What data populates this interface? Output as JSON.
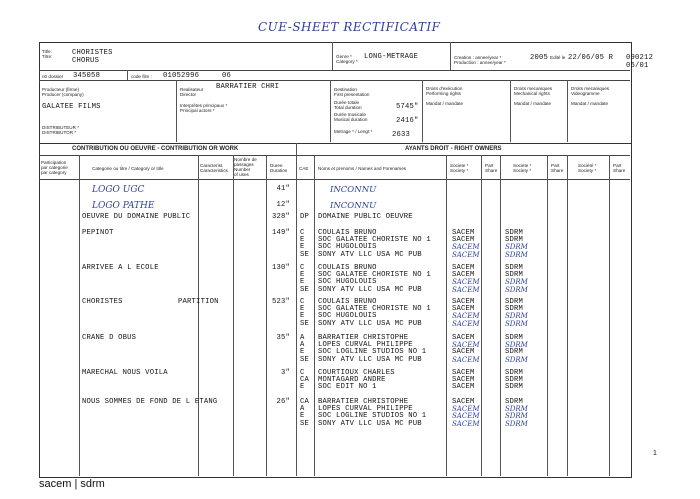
{
  "handwritten_title": "CUE-SHEET RECTIFICATIF",
  "header": {
    "title_label": "Title:\nTitre:",
    "title_value": "CHORISTES",
    "title_value2": "CHORUS",
    "genre_label": "Genre *\nCategory *",
    "genre_value": "LONG-METRAGE",
    "creation_label": "Creation : annee/year *\nProduction : annee/year *",
    "creation_value": "2005",
    "edite_label": "Edité le",
    "edite_value": "22/06/05 R",
    "docnum": "090212",
    "page": "05/01",
    "dossier_label": "n0 dossier",
    "dossier_value": "345058",
    "code_film_label": "code film :",
    "code_film_value": "01052996",
    "code_film_suffix": "06",
    "producteur_label": "Producteur (firme)\nProducer (company)",
    "producteur_value": "GALATEE FILMS",
    "realisateur_label": "Realisateur\nDirector",
    "realisateur_value": "BARRATIER CHRI",
    "interpretes_label": "Interprètes principaux *\nPrincipal actors *",
    "destination_label": "Destination\nFirst presentation",
    "duree_totale_label": "Durée totale\nTotal duration",
    "duree_totale_value": "5745\"",
    "duree_musicale_label": "Durée musicale\nMusical duration",
    "duree_musicale_value": "2416\"",
    "metrage_label": "Metrage * / Lengt *",
    "metrage_value": "2633",
    "distributeur_label": "DISTRIBUTEUR *\nDISTRIBUTOR *",
    "droits_exec_label": "Droits d'exécution\nPerforming rights",
    "droits_exec_value": "Mandat / mandate",
    "droits_meca_label": "Droits mecaniques\nMechanical rights",
    "droits_meca_value": "Mandat / mandate",
    "droits_video_label": "Droits mecaniques\nVideogramme",
    "droits_video_value": "Mandat / mandate"
  },
  "section_headers": {
    "contribution": "CONTRIBUTION OU OEUVRE - CONTRIBUTION OR WORK",
    "ayants": "AYANTS DROIT - RIGHT OWNERS"
  },
  "columns": {
    "participation": "Participation\npar categorie\npar category",
    "categorie": "Categorie ou titre / Category or title",
    "caracterist": "Caracterist.\nCaracteristics",
    "nombre": "Nombre de\npassages\nNumber\nof uses",
    "duree": "Duree\nDuration",
    "cae": "CAE",
    "noms": "Noms et prenoms / Names and Forenames",
    "societe1": "Societe *\nSociety *",
    "part1": "Part\nShare",
    "societe2": "Societe *\nSociety *",
    "part2": "Part\nShare",
    "societe3": "Société *\nSociety *",
    "part3": "Part\nShare"
  },
  "works": [
    {
      "title": "LOGO UGC",
      "handwritten": true,
      "duration": "41\"",
      "rows": [
        {
          "cae": "",
          "name": "INCONNU",
          "name_hand": true,
          "soc1": "",
          "soc2": ""
        }
      ]
    },
    {
      "title": "LOGO PATHE",
      "handwritten": true,
      "duration": "12\"",
      "rows": [
        {
          "cae": "",
          "name": "INCONNU",
          "name_hand": true,
          "soc1": "",
          "soc2": ""
        }
      ]
    },
    {
      "title": "OEUVRE DU DOMAINE PUBLIC",
      "duration": "328\"",
      "rows": [
        {
          "cae": "DP",
          "name": "DOMAINE PUBLIC OEUVRE",
          "soc1": "",
          "soc2": ""
        }
      ]
    },
    {
      "title": "PEPINOT",
      "duration": "149\"",
      "rows": [
        {
          "cae": "C",
          "name": "COULAIS BRUNO",
          "soc1": "SACEM",
          "soc2": "SDRM"
        },
        {
          "cae": "E",
          "name": "SOC GALATEE CHORISTE NO 1",
          "soc1": "SACEM",
          "soc2": "SDRM"
        },
        {
          "cae": "E",
          "name": "SOC HUGOLOUIS",
          "soc1": "SACEM",
          "soc1_hand": true,
          "soc2": "SDRM",
          "soc2_hand": true
        },
        {
          "cae": "SE",
          "name": "SONY ATV LLC USA MC PUB",
          "soc1": "SACEM",
          "soc1_hand": true,
          "soc2": "SDRM",
          "soc2_hand": true
        }
      ]
    },
    {
      "title": "ARRIVEE A L ECOLE",
      "duration": "130\"",
      "rows": [
        {
          "cae": "C",
          "name": "COULAIS BRUNO",
          "soc1": "SACEM",
          "soc2": "SDRM"
        },
        {
          "cae": "E",
          "name": "SOC GALATEE CHORISTE NO 1",
          "soc1": "SACEM",
          "soc2": "SDRM"
        },
        {
          "cae": "E",
          "name": "SOC HUGOLOUIS",
          "soc1": "SACEM",
          "soc1_hand": true,
          "soc2": "SDRM",
          "soc2_hand": true
        },
        {
          "cae": "SE",
          "name": "SONY ATV LLC USA MC PUB",
          "soc1": "SACEM",
          "soc1_hand": true,
          "soc2": "SDRM",
          "soc2_hand": true
        }
      ]
    },
    {
      "title": "CHORISTES",
      "title_extra": "PARTITION",
      "duration": "523\"",
      "rows": [
        {
          "cae": "C",
          "name": "COULAIS BRUNO",
          "soc1": "SACEM",
          "soc2": "SDRM"
        },
        {
          "cae": "E",
          "name": "SOC GALATEE CHORISTE NO 1",
          "soc1": "SACEM",
          "soc2": "SDRM"
        },
        {
          "cae": "E",
          "name": "SOC HUGOLOUIS",
          "soc1": "SACEM",
          "soc1_hand": true,
          "soc2": "SDRM",
          "soc2_hand": true
        },
        {
          "cae": "SE",
          "name": "SONY ATV LLC USA MC PUB",
          "soc1": "SACEM",
          "soc1_hand": true,
          "soc2": "SDRM",
          "soc2_hand": true
        }
      ]
    },
    {
      "title": "CRANE D OBUS",
      "duration": "35\"",
      "rows": [
        {
          "cae": "A",
          "name": "BARRATIER CHRISTOPHE",
          "soc1": "SACEM",
          "soc2": "SDRM"
        },
        {
          "cae": "A",
          "name": "LOPES CURVAL PHILIPPE",
          "soc1": "SACEM",
          "soc1_hand": true,
          "soc2": "SDRM",
          "soc2_hand": true
        },
        {
          "cae": "E",
          "name": "SOC LOGLINE STUDIOS  NO 1",
          "soc1": "SACEM",
          "soc2": "SDRM"
        },
        {
          "cae": "SE",
          "name": "SONY ATV LLC USA MC PUB",
          "soc1": "SACEM",
          "soc1_hand": true,
          "soc2": "SDRM",
          "soc2_hand": true
        }
      ]
    },
    {
      "title": "MARECHAL NOUS VOILA",
      "duration": "3\"",
      "rows": [
        {
          "cae": "C",
          "name": "COURTIOUX CHARLES",
          "soc1": "SACEM",
          "soc2": "SDRM"
        },
        {
          "cae": "CA",
          "name": "MONTAGARD ANDRE",
          "soc1": "SACEM",
          "soc2": "SDRM"
        },
        {
          "cae": "E",
          "name": "SOC EDIT NO 1",
          "soc1": "SACEM",
          "soc2": "SDRM"
        }
      ]
    },
    {
      "title": "NOUS SOMMES DE FOND DE L ETANG",
      "duration": "26\"",
      "rows": [
        {
          "cae": "CA",
          "name": "BARRATIER CHRISTOPHE",
          "soc1": "SACEM",
          "soc2": "SDRM"
        },
        {
          "cae": "A",
          "name": "LOPES CURVAL PHILIPPE",
          "soc1": "SACEM",
          "soc1_hand": true,
          "soc2": "SDRM",
          "soc2_hand": true
        },
        {
          "cae": "E",
          "name": "SOC LOGLINE STUDIOS  NO 1",
          "soc1": "SACEM",
          "soc1_hand": true,
          "soc2": "SDRM",
          "soc2_hand": true
        },
        {
          "cae": "SE",
          "name": "SONY ATV LLC USA MC PUB",
          "soc1": "SACEM",
          "soc1_hand": true,
          "soc2": "SDRM",
          "soc2_hand": true
        }
      ]
    }
  ],
  "page_number": "1",
  "footer_logo": "sacem | sdrm"
}
